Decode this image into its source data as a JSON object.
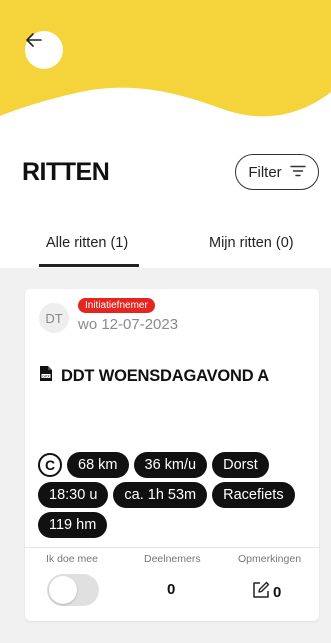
{
  "colors": {
    "header_yellow": "#f5d33a",
    "badge_red": "#e5251f",
    "chip_black": "#111111"
  },
  "header": {
    "back_icon": "arrow-left-icon"
  },
  "page": {
    "title": "RITTEN",
    "filter_label": "Filter",
    "filter_icon": "filter-lines-icon"
  },
  "tabs": [
    {
      "label": "Alle ritten (1)",
      "active": true
    },
    {
      "label": "Mijn ritten (0)",
      "active": false
    }
  ],
  "ride": {
    "avatar_initials": "DT",
    "badge": "Initiatiefnemer",
    "date": "wo 12-07-2023",
    "file_icon": "gpx-file-icon",
    "title": "DDT WOENSDAGAVOND A",
    "category": "C",
    "chips_row1": [
      "68 km",
      "36 km/u",
      "Dorst"
    ],
    "chips_row2": [
      "18:30 u",
      "ca. 1h 53m",
      "Racefiets"
    ],
    "chips_row3": [
      "119 hm"
    ],
    "join_label": "Ik doe mee",
    "join_on": false,
    "participants_label": "Deelnemers",
    "participants_count": "0",
    "notes_label": "Opmerkingen",
    "notes_count": "0"
  }
}
